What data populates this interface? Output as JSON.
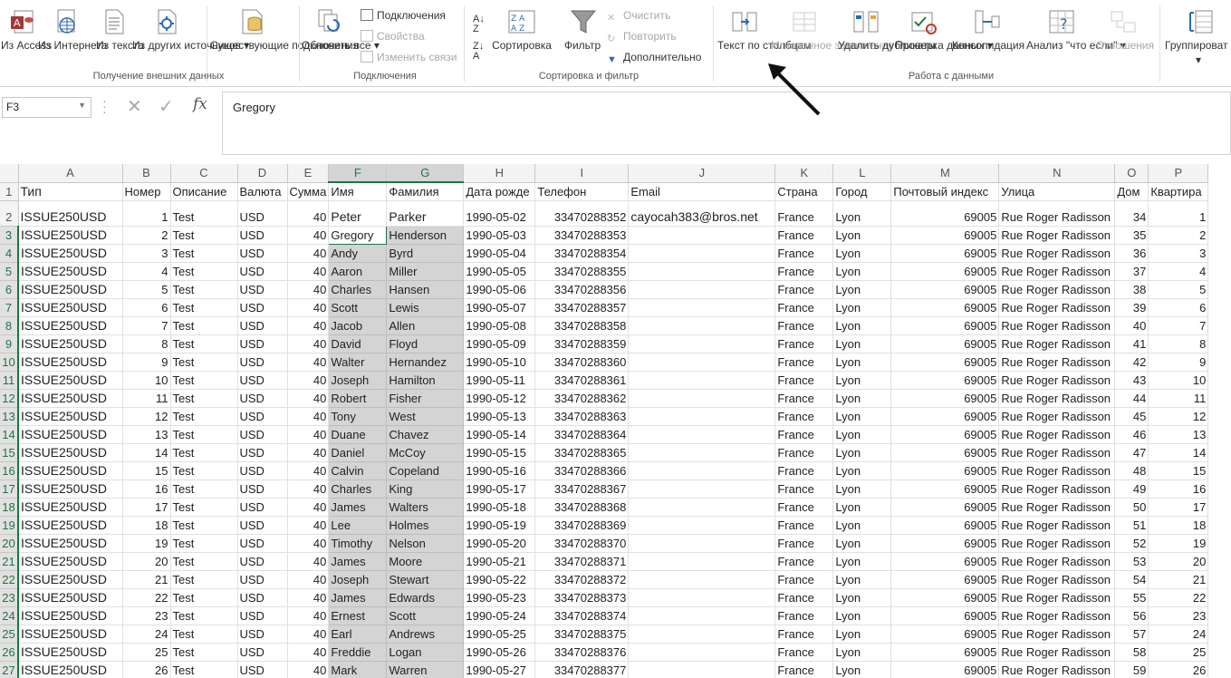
{
  "ribbon": {
    "get_external": {
      "access": "Из Access",
      "web": "Из Интернета",
      "text": "Из текста",
      "other": "Из других источников",
      "existing": "Существующие подключения",
      "label": "Получение внешних данных"
    },
    "connections": {
      "refresh": "Обновить все",
      "conn": "Подключения",
      "props": "Свойства",
      "edit_links": "Изменить связи",
      "label": "Подключения"
    },
    "sort_filter": {
      "sort": "Сортировка",
      "filter": "Фильтр",
      "clear": "Очистить",
      "reapply": "Повторить",
      "advanced": "Дополнительно",
      "label": "Сортировка и фильтр"
    },
    "data_tools": {
      "text_to_cols": "Текст по столбцам",
      "flash_fill": "Мгновенное заполнение",
      "remove_dup": "Удалить дубликаты",
      "validation": "Проверка данных",
      "consolidate": "Консолидация",
      "whatif": "Анализ \"что если\"",
      "relations": "Отношения",
      "label": "Работа с данными"
    },
    "outline": {
      "group": "Группироват"
    }
  },
  "formula_bar": {
    "cell_ref": "F3",
    "content": "Gregory",
    "fx": "fx"
  },
  "columns": [
    "A",
    "B",
    "C",
    "D",
    "E",
    "F",
    "G",
    "H",
    "I",
    "J",
    "K",
    "L",
    "M",
    "N",
    "O",
    "P"
  ],
  "headers": [
    "Тип",
    "Номер",
    "Описание",
    "Валюта",
    "Сумма",
    "Имя",
    "Фамилия",
    "Дата рожде",
    "Телефон",
    "Email",
    "Страна",
    "Город",
    "Почтовый индекс",
    "Улица",
    "Дом",
    "Квартира"
  ],
  "rows": [
    [
      "ISSUE250USD",
      "1",
      "Test",
      "USD",
      "40",
      "Peter",
      "Parker",
      "1990-05-02",
      "33470288352",
      "cayocah383@bros.net",
      "France",
      "Lyon",
      "69005",
      "Rue Roger Radisson",
      "34",
      "1"
    ],
    [
      "ISSUE250USD",
      "2",
      "Test",
      "USD",
      "40",
      "Gregory",
      "Henderson",
      "1990-05-03",
      "33470288353",
      "",
      "France",
      "Lyon",
      "69005",
      "Rue Roger Radisson",
      "35",
      "2"
    ],
    [
      "ISSUE250USD",
      "3",
      "Test",
      "USD",
      "40",
      "Andy",
      "Byrd",
      "1990-05-04",
      "33470288354",
      "",
      "France",
      "Lyon",
      "69005",
      "Rue Roger Radisson",
      "36",
      "3"
    ],
    [
      "ISSUE250USD",
      "4",
      "Test",
      "USD",
      "40",
      "Aaron",
      "Miller",
      "1990-05-05",
      "33470288355",
      "",
      "France",
      "Lyon",
      "69005",
      "Rue Roger Radisson",
      "37",
      "4"
    ],
    [
      "ISSUE250USD",
      "5",
      "Test",
      "USD",
      "40",
      "Charles",
      "Hansen",
      "1990-05-06",
      "33470288356",
      "",
      "France",
      "Lyon",
      "69005",
      "Rue Roger Radisson",
      "38",
      "5"
    ],
    [
      "ISSUE250USD",
      "6",
      "Test",
      "USD",
      "40",
      "Scott",
      "Lewis",
      "1990-05-07",
      "33470288357",
      "",
      "France",
      "Lyon",
      "69005",
      "Rue Roger Radisson",
      "39",
      "6"
    ],
    [
      "ISSUE250USD",
      "7",
      "Test",
      "USD",
      "40",
      "Jacob",
      "Allen",
      "1990-05-08",
      "33470288358",
      "",
      "France",
      "Lyon",
      "69005",
      "Rue Roger Radisson",
      "40",
      "7"
    ],
    [
      "ISSUE250USD",
      "8",
      "Test",
      "USD",
      "40",
      "David",
      "Floyd",
      "1990-05-09",
      "33470288359",
      "",
      "France",
      "Lyon",
      "69005",
      "Rue Roger Radisson",
      "41",
      "8"
    ],
    [
      "ISSUE250USD",
      "9",
      "Test",
      "USD",
      "40",
      "Walter",
      "Hernandez",
      "1990-05-10",
      "33470288360",
      "",
      "France",
      "Lyon",
      "69005",
      "Rue Roger Radisson",
      "42",
      "9"
    ],
    [
      "ISSUE250USD",
      "10",
      "Test",
      "USD",
      "40",
      "Joseph",
      "Hamilton",
      "1990-05-11",
      "33470288361",
      "",
      "France",
      "Lyon",
      "69005",
      "Rue Roger Radisson",
      "43",
      "10"
    ],
    [
      "ISSUE250USD",
      "11",
      "Test",
      "USD",
      "40",
      "Robert",
      "Fisher",
      "1990-05-12",
      "33470288362",
      "",
      "France",
      "Lyon",
      "69005",
      "Rue Roger Radisson",
      "44",
      "11"
    ],
    [
      "ISSUE250USD",
      "12",
      "Test",
      "USD",
      "40",
      "Tony",
      "West",
      "1990-05-13",
      "33470288363",
      "",
      "France",
      "Lyon",
      "69005",
      "Rue Roger Radisson",
      "45",
      "12"
    ],
    [
      "ISSUE250USD",
      "13",
      "Test",
      "USD",
      "40",
      "Duane",
      "Chavez",
      "1990-05-14",
      "33470288364",
      "",
      "France",
      "Lyon",
      "69005",
      "Rue Roger Radisson",
      "46",
      "13"
    ],
    [
      "ISSUE250USD",
      "14",
      "Test",
      "USD",
      "40",
      "Daniel",
      "McCoy",
      "1990-05-15",
      "33470288365",
      "",
      "France",
      "Lyon",
      "69005",
      "Rue Roger Radisson",
      "47",
      "14"
    ],
    [
      "ISSUE250USD",
      "15",
      "Test",
      "USD",
      "40",
      "Calvin",
      "Copeland",
      "1990-05-16",
      "33470288366",
      "",
      "France",
      "Lyon",
      "69005",
      "Rue Roger Radisson",
      "48",
      "15"
    ],
    [
      "ISSUE250USD",
      "16",
      "Test",
      "USD",
      "40",
      "Charles",
      "King",
      "1990-05-17",
      "33470288367",
      "",
      "France",
      "Lyon",
      "69005",
      "Rue Roger Radisson",
      "49",
      "16"
    ],
    [
      "ISSUE250USD",
      "17",
      "Test",
      "USD",
      "40",
      "James",
      "Walters",
      "1990-05-18",
      "33470288368",
      "",
      "France",
      "Lyon",
      "69005",
      "Rue Roger Radisson",
      "50",
      "17"
    ],
    [
      "ISSUE250USD",
      "18",
      "Test",
      "USD",
      "40",
      "Lee",
      "Holmes",
      "1990-05-19",
      "33470288369",
      "",
      "France",
      "Lyon",
      "69005",
      "Rue Roger Radisson",
      "51",
      "18"
    ],
    [
      "ISSUE250USD",
      "19",
      "Test",
      "USD",
      "40",
      "Timothy",
      "Nelson",
      "1990-05-20",
      "33470288370",
      "",
      "France",
      "Lyon",
      "69005",
      "Rue Roger Radisson",
      "52",
      "19"
    ],
    [
      "ISSUE250USD",
      "20",
      "Test",
      "USD",
      "40",
      "James",
      "Moore",
      "1990-05-21",
      "33470288371",
      "",
      "France",
      "Lyon",
      "69005",
      "Rue Roger Radisson",
      "53",
      "20"
    ],
    [
      "ISSUE250USD",
      "21",
      "Test",
      "USD",
      "40",
      "Joseph",
      "Stewart",
      "1990-05-22",
      "33470288372",
      "",
      "France",
      "Lyon",
      "69005",
      "Rue Roger Radisson",
      "54",
      "21"
    ],
    [
      "ISSUE250USD",
      "22",
      "Test",
      "USD",
      "40",
      "James",
      "Edwards",
      "1990-05-23",
      "33470288373",
      "",
      "France",
      "Lyon",
      "69005",
      "Rue Roger Radisson",
      "55",
      "22"
    ],
    [
      "ISSUE250USD",
      "23",
      "Test",
      "USD",
      "40",
      "Ernest",
      "Scott",
      "1990-05-24",
      "33470288374",
      "",
      "France",
      "Lyon",
      "69005",
      "Rue Roger Radisson",
      "56",
      "23"
    ],
    [
      "ISSUE250USD",
      "24",
      "Test",
      "USD",
      "40",
      "Earl",
      "Andrews",
      "1990-05-25",
      "33470288375",
      "",
      "France",
      "Lyon",
      "69005",
      "Rue Roger Radisson",
      "57",
      "24"
    ],
    [
      "ISSUE250USD",
      "25",
      "Test",
      "USD",
      "40",
      "Freddie",
      "Logan",
      "1990-05-26",
      "33470288376",
      "",
      "France",
      "Lyon",
      "69005",
      "Rue Roger Radisson",
      "58",
      "25"
    ],
    [
      "ISSUE250USD",
      "26",
      "Test",
      "USD",
      "40",
      "Mark",
      "Warren",
      "1990-05-27",
      "33470288377",
      "",
      "France",
      "Lyon",
      "69005",
      "Rue Roger Radisson",
      "59",
      "26"
    ]
  ]
}
